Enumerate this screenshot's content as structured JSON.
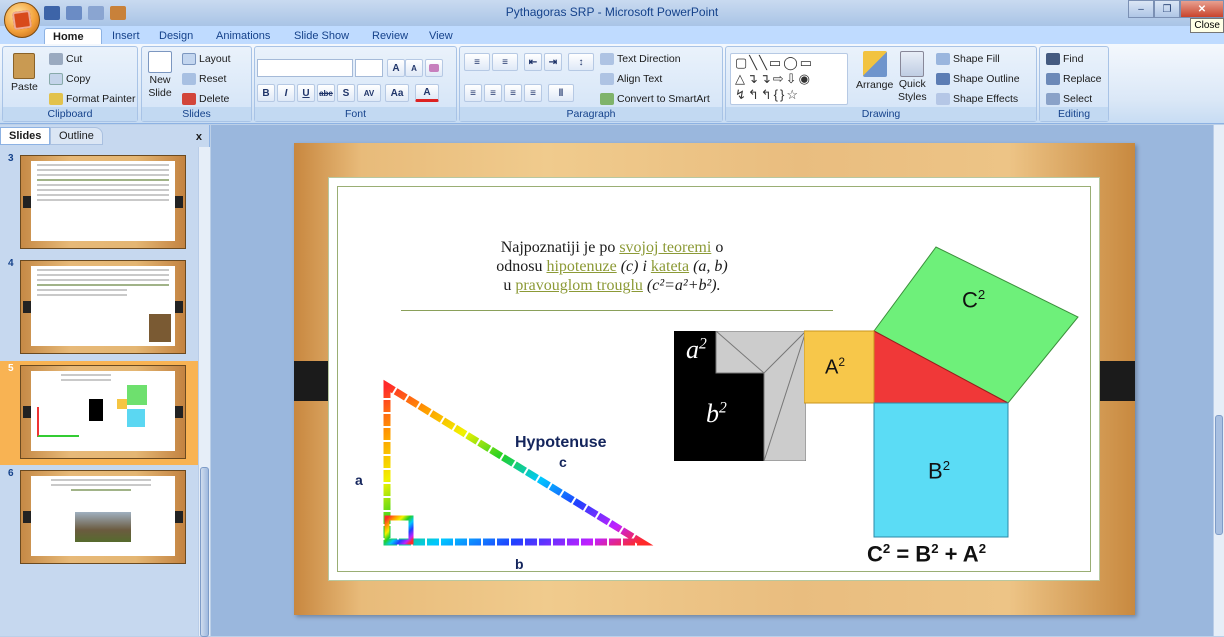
{
  "window": {
    "title": "Pythagoras SRP - Microsoft PowerPoint",
    "close_tooltip": "Close"
  },
  "tabs": [
    "Home",
    "Insert",
    "Design",
    "Animations",
    "Slide Show",
    "Review",
    "View"
  ],
  "ribbon": {
    "clipboard": {
      "label": "Clipboard",
      "paste": "Paste",
      "cut": "Cut",
      "copy": "Copy",
      "format_painter": "Format Painter"
    },
    "slides": {
      "label": "Slides",
      "new_slide": "New",
      "new_slide2": "Slide",
      "layout": "Layout",
      "reset": "Reset",
      "delete": "Delete"
    },
    "font": {
      "label": "Font",
      "bold": "B",
      "italic": "I",
      "underline": "U",
      "strike": "abe",
      "shadow": "S",
      "spacing": "AV",
      "case": "Aa",
      "grow": "A",
      "shrink": "A"
    },
    "paragraph": {
      "label": "Paragraph",
      "text_direction": "Text Direction",
      "align_text": "Align Text",
      "convert_smartart": "Convert to SmartArt"
    },
    "drawing": {
      "label": "Drawing",
      "arrange": "Arrange",
      "quick_styles": "Quick",
      "quick_styles2": "Styles",
      "shape_fill": "Shape Fill",
      "shape_outline": "Shape Outline",
      "shape_effects": "Shape Effects"
    },
    "editing": {
      "label": "Editing",
      "find": "Find",
      "replace": "Replace",
      "select": "Select"
    }
  },
  "panel": {
    "tab_slides": "Slides",
    "tab_outline": "Outline",
    "close": "x",
    "slides": [
      {
        "num": "3"
      },
      {
        "num": "4"
      },
      {
        "num": "5"
      },
      {
        "num": "6"
      }
    ]
  },
  "slide": {
    "text_line1_a": "Najpoznatiji je po ",
    "text_line1_link": "svojoj teoremi",
    "text_line1_b": " o",
    "text_line2_a": "odnosu ",
    "text_line2_link1": "hipotenuze",
    "text_line2_b": " (c) i ",
    "text_line2_link2": "kateta",
    "text_line2_c": " (a, b)",
    "text_line3_a": "u ",
    "text_line3_link": "pravouglom trouglu",
    "text_line3_b": " (c²=a²+b²).",
    "tri_hyp": "Hypotenuse",
    "tri_c": "c",
    "tri_a": "a",
    "tri_b": "b",
    "sq_a": "a",
    "sq_b": "b",
    "A": "A",
    "B": "B",
    "C": "C",
    "formula_C": "C",
    "formula_eq": " = B",
    "formula_plus": " + A",
    "sup2": "2"
  }
}
